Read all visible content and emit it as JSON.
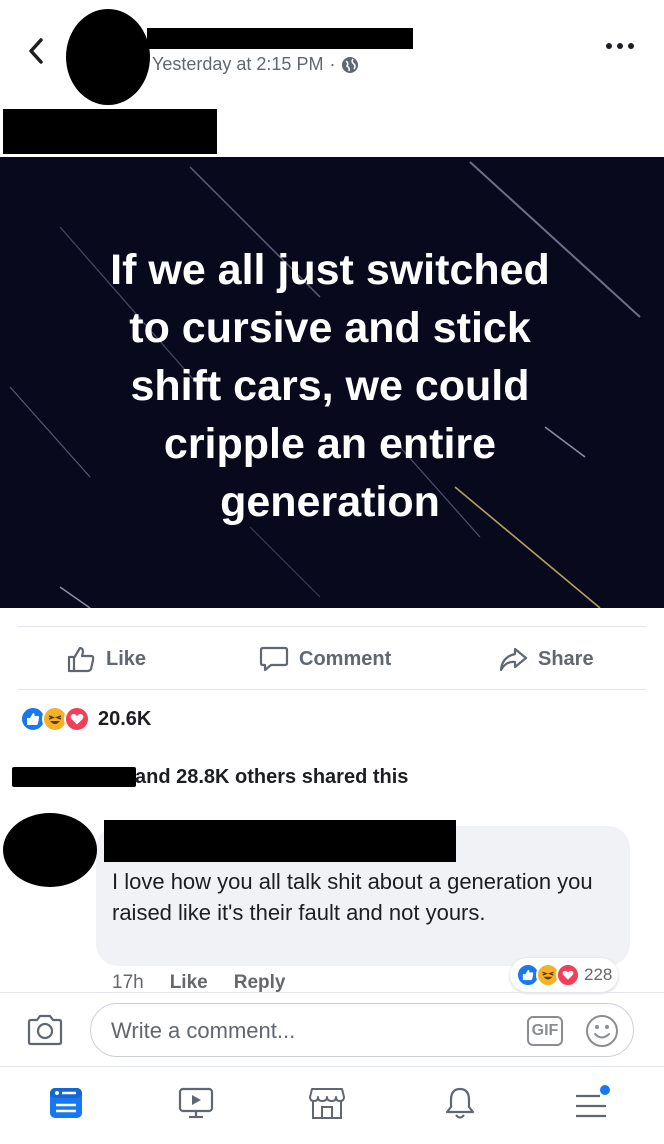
{
  "post": {
    "timestamp": "Yesterday at 2:15 PM",
    "privacy_icon": "globe-icon",
    "image_text_lines": [
      "If we all just switched",
      "to cursive and stick",
      "shift cars, we could",
      "cripple an entire",
      "generation"
    ]
  },
  "actions": {
    "like_label": "Like",
    "comment_label": "Comment",
    "share_label": "Share"
  },
  "reactions": {
    "count": "20.6K",
    "types": [
      "like",
      "haha",
      "love"
    ]
  },
  "shares": {
    "text": "and 28.8K others shared this"
  },
  "comment": {
    "text": "I love how you all talk shit about a generation you raised like it's their fault and not yours.",
    "time": "17h",
    "like_label": "Like",
    "reply_label": "Reply",
    "reaction_count": "228"
  },
  "compose": {
    "placeholder": "Write a comment...",
    "gif_label": "GIF"
  },
  "colors": {
    "brand_blue": "#1877f2",
    "haha_yellow": "#f7b125",
    "love_red": "#f33e58",
    "muted_text": "#606770",
    "post_background": "#08091c"
  },
  "bottom_nav": [
    "news-feed-icon",
    "watch-icon",
    "marketplace-icon",
    "notifications-icon",
    "menu-icon"
  ]
}
